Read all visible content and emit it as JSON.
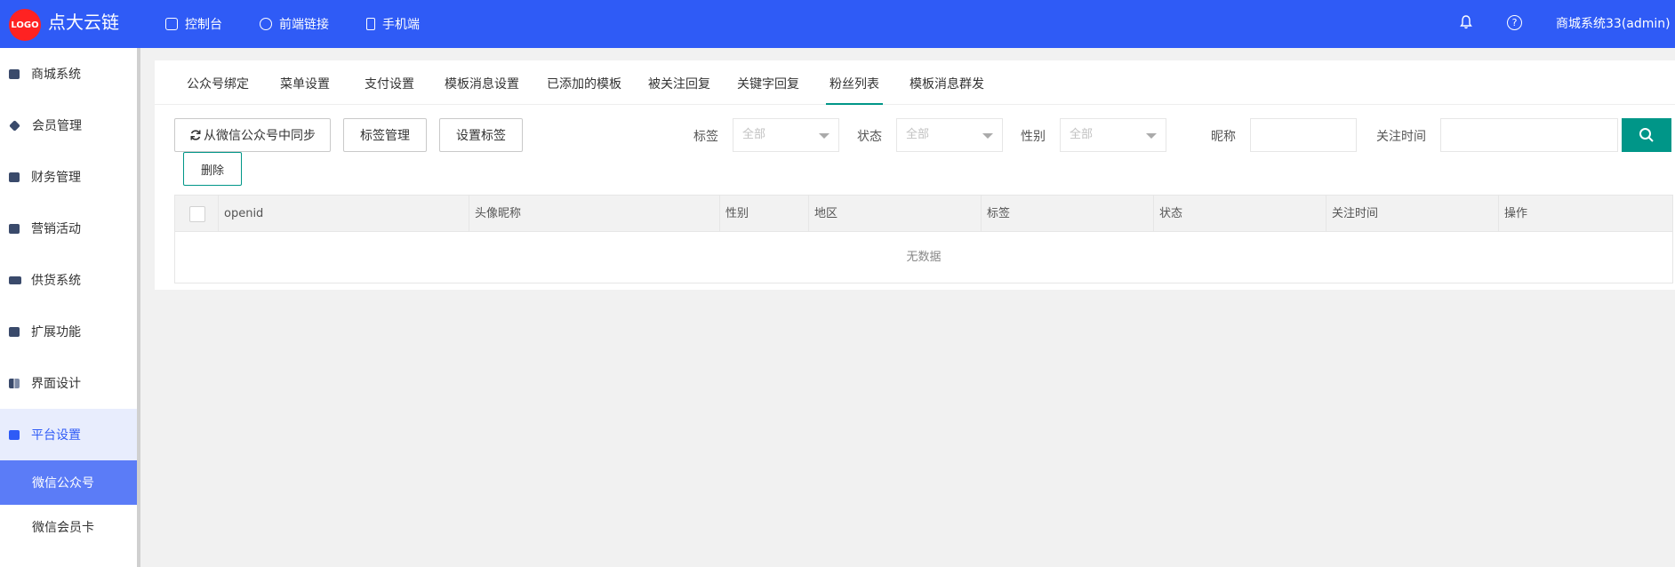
{
  "header": {
    "logo_text": "LOGO",
    "brand": "点大云链",
    "nav": [
      {
        "label": "控制台",
        "icon": "dashboard-icon"
      },
      {
        "label": "前端链接",
        "icon": "edit-icon"
      },
      {
        "label": "手机端",
        "icon": "phone-icon"
      }
    ],
    "user": "商城系统33(admin)"
  },
  "sidebar": {
    "items": [
      {
        "label": "商城系统",
        "icon": "shop-icon"
      },
      {
        "label": "会员管理",
        "icon": "diamond-icon"
      },
      {
        "label": "财务管理",
        "icon": "finance-icon"
      },
      {
        "label": "营销活动",
        "icon": "calendar-icon"
      },
      {
        "label": "供货系统",
        "icon": "truck-icon"
      },
      {
        "label": "扩展功能",
        "icon": "puzzle-icon"
      },
      {
        "label": "界面设计",
        "icon": "layout-icon"
      },
      {
        "label": "平台设置",
        "icon": "monitor-icon"
      }
    ],
    "sub_items": [
      {
        "label": "微信公众号"
      },
      {
        "label": "微信会员卡"
      }
    ]
  },
  "tabs": [
    {
      "label": "公众号绑定"
    },
    {
      "label": "菜单设置"
    },
    {
      "label": "支付设置"
    },
    {
      "label": "模板消息设置"
    },
    {
      "label": "已添加的模板"
    },
    {
      "label": "被关注回复"
    },
    {
      "label": "关键字回复"
    },
    {
      "label": "粉丝列表"
    },
    {
      "label": "模板消息群发"
    }
  ],
  "toolbar": {
    "sync_label": "从微信公众号中同步",
    "tag_manage_label": "标签管理",
    "set_tag_label": "设置标签",
    "delete_label": "删除"
  },
  "filters": {
    "tag_label": "标签",
    "tag_value": "全部",
    "status_label": "状态",
    "status_value": "全部",
    "gender_label": "性别",
    "gender_value": "全部",
    "nickname_label": "昵称",
    "nickname_value": "",
    "follow_time_label": "关注时间",
    "follow_time_value": ""
  },
  "table": {
    "columns": [
      "openid",
      "头像昵称",
      "性别",
      "地区",
      "标签",
      "状态",
      "关注时间",
      "操作"
    ],
    "empty_text": "无数据"
  },
  "colors": {
    "header_bg": "#2f5bf6",
    "accent_green": "#009688",
    "active_sub_bg": "#5b7cf7"
  }
}
